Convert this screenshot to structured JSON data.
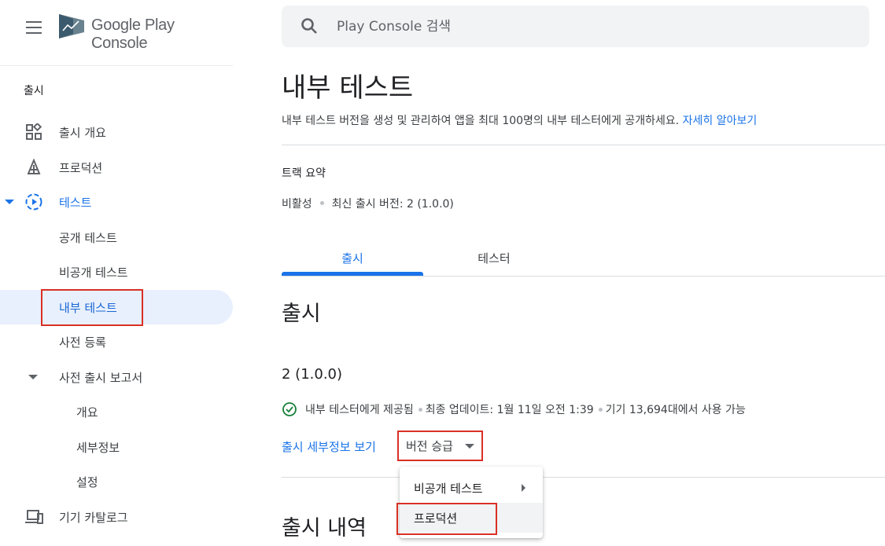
{
  "app": {
    "logo_text": "Google Play Console",
    "brand_colors": {
      "accent": "#1a73e8",
      "logo_dark": "#3c5a6e",
      "logo_light": "#69828f",
      "highlight_box": "#d93025"
    }
  },
  "sidebar": {
    "section_label": "출시",
    "items": [
      {
        "label": "출시 개요",
        "icon": "dashboard-icon"
      },
      {
        "label": "프로덕션",
        "icon": "production-icon"
      },
      {
        "label": "테스트",
        "icon": "testing-icon",
        "expanded": true
      },
      {
        "label": "공개 테스트"
      },
      {
        "label": "비공개 테스트"
      },
      {
        "label": "내부 테스트",
        "selected": true
      },
      {
        "label": "사전 등록"
      },
      {
        "label": "사전 출시 보고서",
        "expanded": true
      },
      {
        "label": "개요"
      },
      {
        "label": "세부정보"
      },
      {
        "label": "설정"
      },
      {
        "label": "기기 카탈로그",
        "icon": "devices-icon"
      }
    ]
  },
  "search": {
    "placeholder": "Play Console 검색"
  },
  "main": {
    "title": "내부 테스트",
    "description": "내부 테스트 버전을 생성 및 관리하여 앱을 최대 100명의 내부 테스터에게 공개하세요.",
    "learn_more": "자세히 알아보기",
    "track_summary": {
      "title": "트랙 요약",
      "status": "비활성",
      "latest_release": "최신 출시 버전: 2 (1.0.0)"
    },
    "tabs": [
      {
        "label": "출시",
        "active": true
      },
      {
        "label": "테스터",
        "active": false
      }
    ],
    "release_section_title": "출시",
    "release": {
      "version": "2 (1.0.0)",
      "status": "내부 테스터에게 제공됨",
      "last_update": "최종 업데이트: 1월 11일 오전 1:39",
      "availability": "기기 13,694대에서 사용 가능",
      "view_details": "출시 세부정보 보기",
      "promote_label": "버전 승급"
    },
    "promote_menu": [
      {
        "label": "비공개 테스트",
        "has_submenu": true
      },
      {
        "label": "프로덕션",
        "has_submenu": false
      }
    ],
    "history_title": "출시 내역"
  }
}
